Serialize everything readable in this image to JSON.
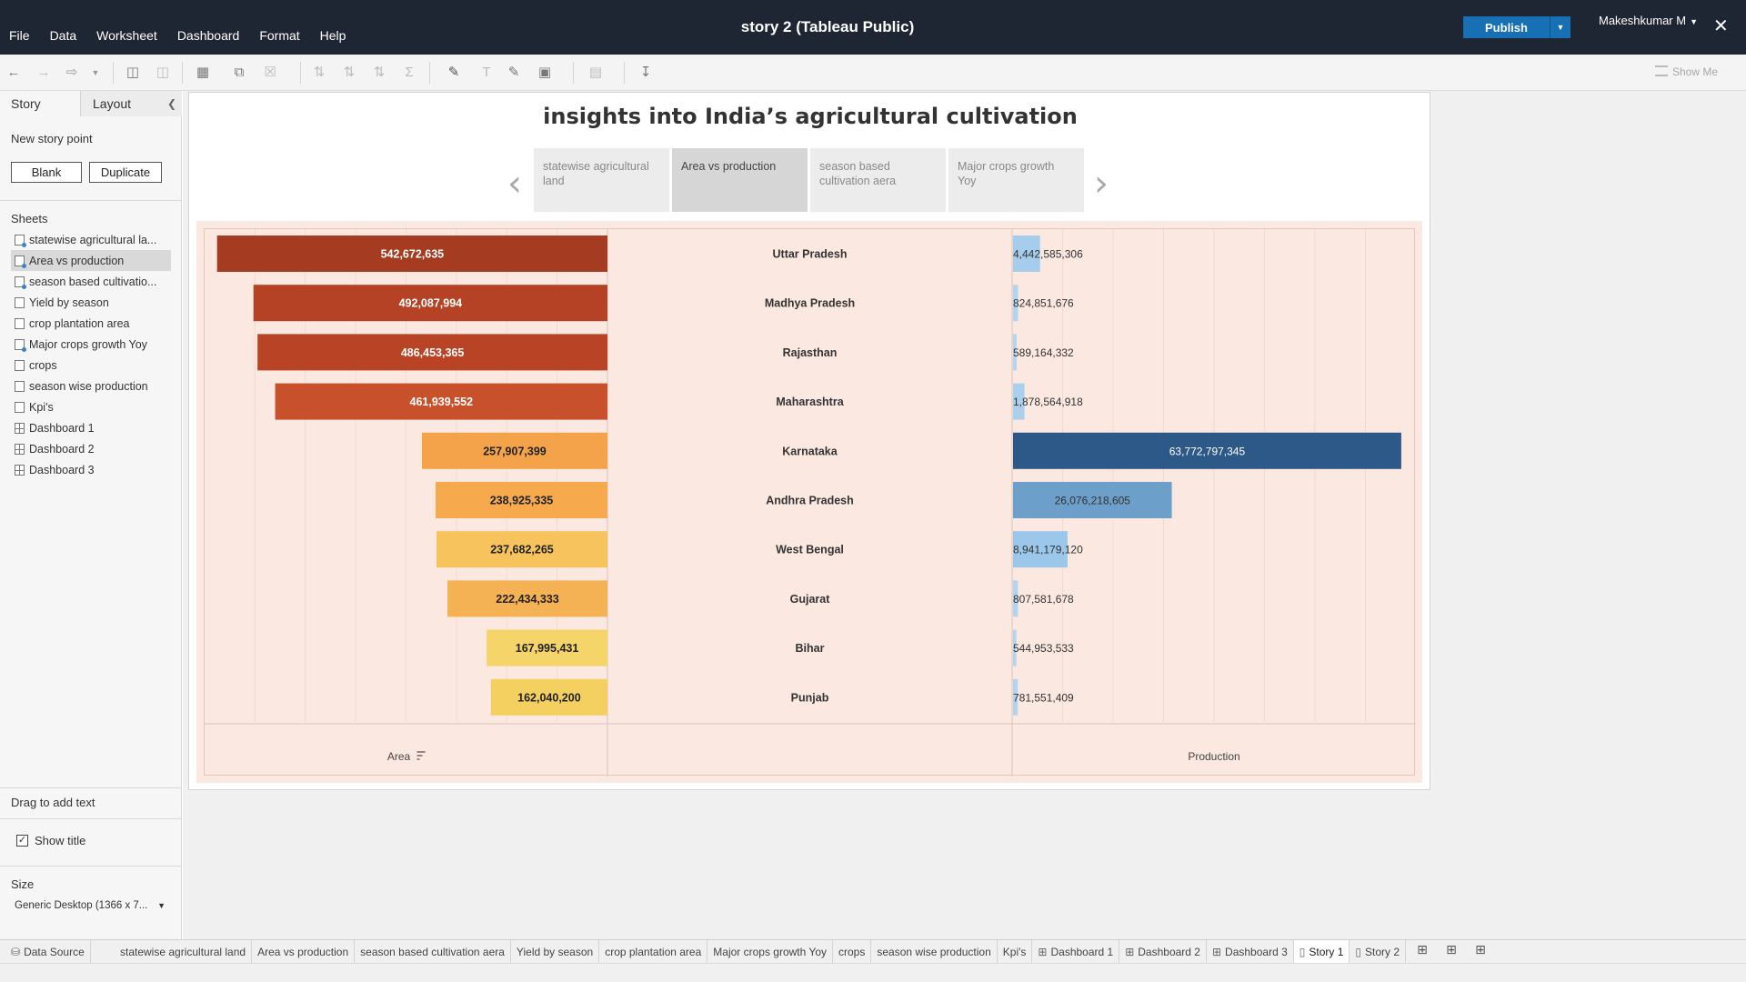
{
  "menu": [
    "File",
    "Data",
    "Worksheet",
    "Dashboard",
    "Format",
    "Help"
  ],
  "app_title": "story 2 (Tableau Public)",
  "publish_label": "Publish",
  "user_name": "Makeshkumar M",
  "toolbar_show_me": "Show Me",
  "left_panel": {
    "tab_story": "Story",
    "tab_layout": "Layout",
    "new_story_point": "New story point",
    "blank_label": "Blank",
    "duplicate_label": "Duplicate",
    "sheets_header": "Sheets",
    "sheets": [
      {
        "label": "statewise agricultural la...",
        "kind": "worksheet",
        "used": true
      },
      {
        "label": "Area vs production",
        "kind": "worksheet",
        "used": true,
        "selected": true
      },
      {
        "label": "season based cultivatio...",
        "kind": "worksheet",
        "used": true
      },
      {
        "label": "Yield by season",
        "kind": "worksheet",
        "used": false
      },
      {
        "label": "crop plantation area",
        "kind": "worksheet",
        "used": false
      },
      {
        "label": "Major crops growth Yoy",
        "kind": "worksheet",
        "used": true
      },
      {
        "label": "crops",
        "kind": "worksheet",
        "used": false
      },
      {
        "label": "season wise production",
        "kind": "worksheet",
        "used": false
      },
      {
        "label": "Kpi's",
        "kind": "worksheet",
        "used": false
      },
      {
        "label": "Dashboard 1",
        "kind": "dashboard",
        "used": false
      },
      {
        "label": "Dashboard 2",
        "kind": "dashboard",
        "used": false
      },
      {
        "label": "Dashboard 3",
        "kind": "dashboard",
        "used": false
      }
    ],
    "drag_text": "Drag to add text",
    "show_title": "Show title",
    "size_header": "Size",
    "size_value": "Generic Desktop (1366 x 7..."
  },
  "story": {
    "title": "insights into India’s agricultural cultivation",
    "points": [
      {
        "label": "statewise agricultural land",
        "active": false
      },
      {
        "label": "Area vs production",
        "active": true
      },
      {
        "label": "season based cultivation aera",
        "active": false
      },
      {
        "label": "Major crops growth Yoy",
        "active": false
      }
    ]
  },
  "chart_data": {
    "type": "bar",
    "categories": [
      "Uttar Pradesh",
      "Madhya Pradesh",
      "Rajasthan",
      "Maharashtra",
      "Karnataka",
      "Andhra Pradesh",
      "West Bengal",
      "Gujarat",
      "Bihar",
      "Punjab"
    ],
    "series": [
      {
        "name": "Area",
        "values": [
          542672635,
          492087994,
          486453365,
          461939552,
          257907399,
          238925335,
          237682265,
          222434333,
          167995431,
          162040200
        ],
        "labels": [
          "542,672,635",
          "492,087,994",
          "486,453,365",
          "461,939,552",
          "257,907,399",
          "238,925,335",
          "237,682,265",
          "222,434,333",
          "167,995,431",
          "162,040,200"
        ],
        "colors": [
          "#a53c22",
          "#b54224",
          "#b84425",
          "#c8502a",
          "#f5a34a",
          "#f7a94e",
          "#f7c35d",
          "#f5b254",
          "#f5d469",
          "#f4d060"
        ],
        "direction": "left"
      },
      {
        "name": "Production",
        "values": [
          4442585306,
          824851676,
          589164332,
          1878564918,
          63772797345,
          26076218605,
          8941179120,
          807581678,
          544953533,
          781551409
        ],
        "labels": [
          "4,442,585,306",
          "824,851,676",
          "589,164,332",
          "1,878,564,918",
          "63,772,797,345",
          "26,076,218,605",
          "8,941,179,120",
          "807,581,678",
          "544,953,533",
          "781,551,409"
        ],
        "colors": [
          "#a6cdec",
          "#b1d4ef",
          "#b3d5ef",
          "#abd0ed",
          "#2c5988",
          "#6c9fc9",
          "#9bc7ea",
          "#b1d4ef",
          "#b3d5ef",
          "#b1d4ef"
        ],
        "direction": "right"
      }
    ],
    "xlabel_area": "Area",
    "xlabel_production": "Production",
    "area_max": 560000000,
    "production_max": 65000000000,
    "sorted_by": "Area"
  },
  "bottom_tabs": {
    "data_source": "Data Source",
    "tabs": [
      {
        "label": "statewise agricultural land",
        "kind": "worksheet"
      },
      {
        "label": "Area vs production",
        "kind": "worksheet"
      },
      {
        "label": "season based cultivation aera",
        "kind": "worksheet"
      },
      {
        "label": "Yield by season",
        "kind": "worksheet"
      },
      {
        "label": "crop plantation area",
        "kind": "worksheet"
      },
      {
        "label": "Major crops growth Yoy",
        "kind": "worksheet"
      },
      {
        "label": "crops",
        "kind": "worksheet"
      },
      {
        "label": "season wise production",
        "kind": "worksheet"
      },
      {
        "label": "Kpi's",
        "kind": "worksheet"
      },
      {
        "label": "Dashboard 1",
        "kind": "dashboard"
      },
      {
        "label": "Dashboard 2",
        "kind": "dashboard"
      },
      {
        "label": "Dashboard 3",
        "kind": "dashboard"
      },
      {
        "label": "Story 1",
        "kind": "story",
        "active": true
      },
      {
        "label": "Story 2",
        "kind": "story"
      }
    ]
  }
}
